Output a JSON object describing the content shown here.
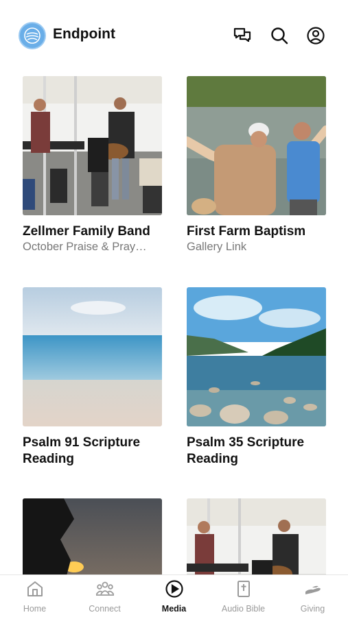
{
  "header": {
    "title": "Endpoint",
    "icons": [
      "logo-icon",
      "chat-icon",
      "search-icon",
      "account-icon"
    ]
  },
  "media_items": [
    {
      "title": "Zellmer Family Band",
      "subtitle": "October Praise & Pray…",
      "image": "band-on-stage"
    },
    {
      "title": "First Farm Baptism",
      "subtitle": "Gallery Link",
      "image": "pond-baptism"
    },
    {
      "title": "Psalm 91 Scripture Reading",
      "subtitle": "",
      "image": "beach-horizon"
    },
    {
      "title": "Psalm 35 Scripture Reading",
      "subtitle": "",
      "image": "lake-rocks"
    },
    {
      "title": "",
      "subtitle": "",
      "image": "sunset-tree"
    },
    {
      "title": "",
      "subtitle": "",
      "image": "band-on-stage"
    }
  ],
  "tabbar": {
    "tabs": [
      {
        "label": "Home",
        "icon": "home-icon"
      },
      {
        "label": "Connect",
        "icon": "people-icon"
      },
      {
        "label": "Media",
        "icon": "play-icon",
        "active": true
      },
      {
        "label": "Audio Bible",
        "icon": "bible-icon"
      },
      {
        "label": "Giving",
        "icon": "giving-icon"
      }
    ]
  },
  "colors": {
    "accent": "#6aaee8",
    "text": "#111111",
    "muted": "#777777"
  }
}
